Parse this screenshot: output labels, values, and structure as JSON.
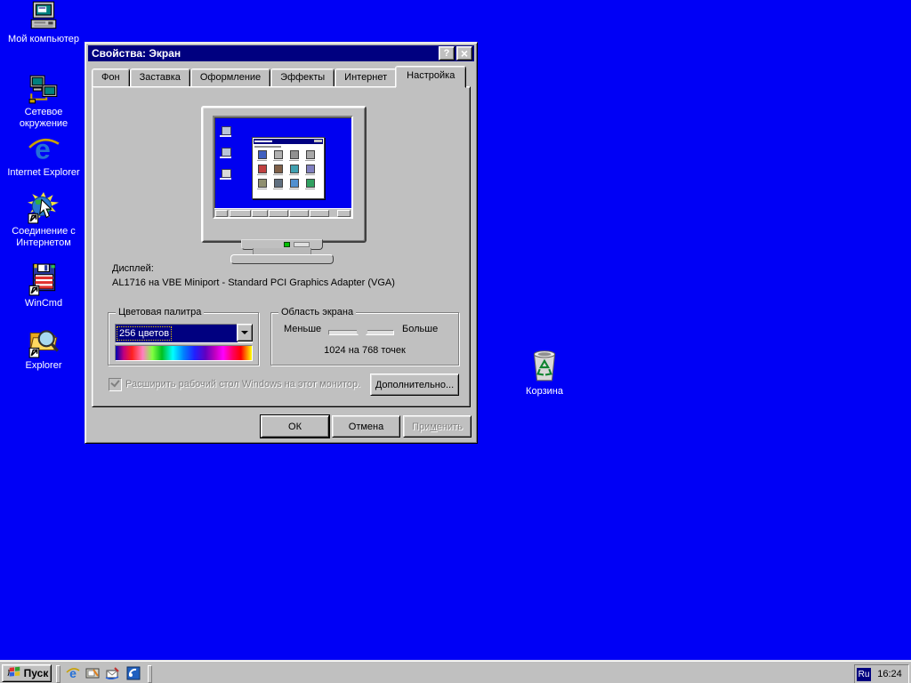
{
  "colors": {
    "desktop": "#0000F6",
    "titlebar": "#000080",
    "face": "#C0C0C0",
    "selection": "#000080",
    "selection_text": "#FFFFFF"
  },
  "desktop": {
    "icons": [
      {
        "label": "Мой компьютер",
        "icon": "my-computer-icon"
      },
      {
        "label": "Сетевое окружение",
        "icon": "network-neighborhood-icon"
      },
      {
        "label": "Internet Explorer",
        "icon": "internet-explorer-icon"
      },
      {
        "label": "Соединение с Интернетом",
        "icon": "connect-internet-icon"
      },
      {
        "label": "WinCmd",
        "icon": "wincmd-icon"
      },
      {
        "label": "Explorer",
        "icon": "explorer-icon"
      }
    ],
    "recycle_bin_label": "Корзина"
  },
  "dialog": {
    "title": "Свойства: Экран",
    "help_glyph": "?",
    "close_glyph": "×",
    "tabs": [
      {
        "label": "Фон"
      },
      {
        "label": "Заставка"
      },
      {
        "label": "Оформление"
      },
      {
        "label": "Эффекты"
      },
      {
        "label": "Интернет"
      },
      {
        "label": "Настройка"
      }
    ],
    "active_tab": "Настройка",
    "display_label": "Дисплей:",
    "display_value": "AL1716 на VBE Miniport - Standard PCI Graphics Adapter (VGA)",
    "color_palette": {
      "title": "Цветовая палитра",
      "selected": "256 цветов"
    },
    "screen_area": {
      "title": "Область экрана",
      "less": "Меньше",
      "more": "Больше",
      "resolution": "1024 на 768 точек"
    },
    "extend_label": "Расширить рабочий стол Windows на этот монитор.",
    "advanced": {
      "accel": "Д",
      "rest": "ополнительно..."
    },
    "buttons": {
      "ok": "ОК",
      "cancel": "Отмена",
      "apply_pre": "При",
      "apply_accel": "м",
      "apply_post": "енить"
    }
  },
  "taskbar": {
    "start_label": "Пуск",
    "start_icon": "windows-logo-icon",
    "quick_launch": [
      {
        "icon": "internet-explorer-icon"
      },
      {
        "icon": "show-desktop-icon"
      },
      {
        "icon": "outlook-express-icon"
      },
      {
        "icon": "view-channels-icon"
      }
    ],
    "language": "Ru",
    "clock": "16:24"
  }
}
